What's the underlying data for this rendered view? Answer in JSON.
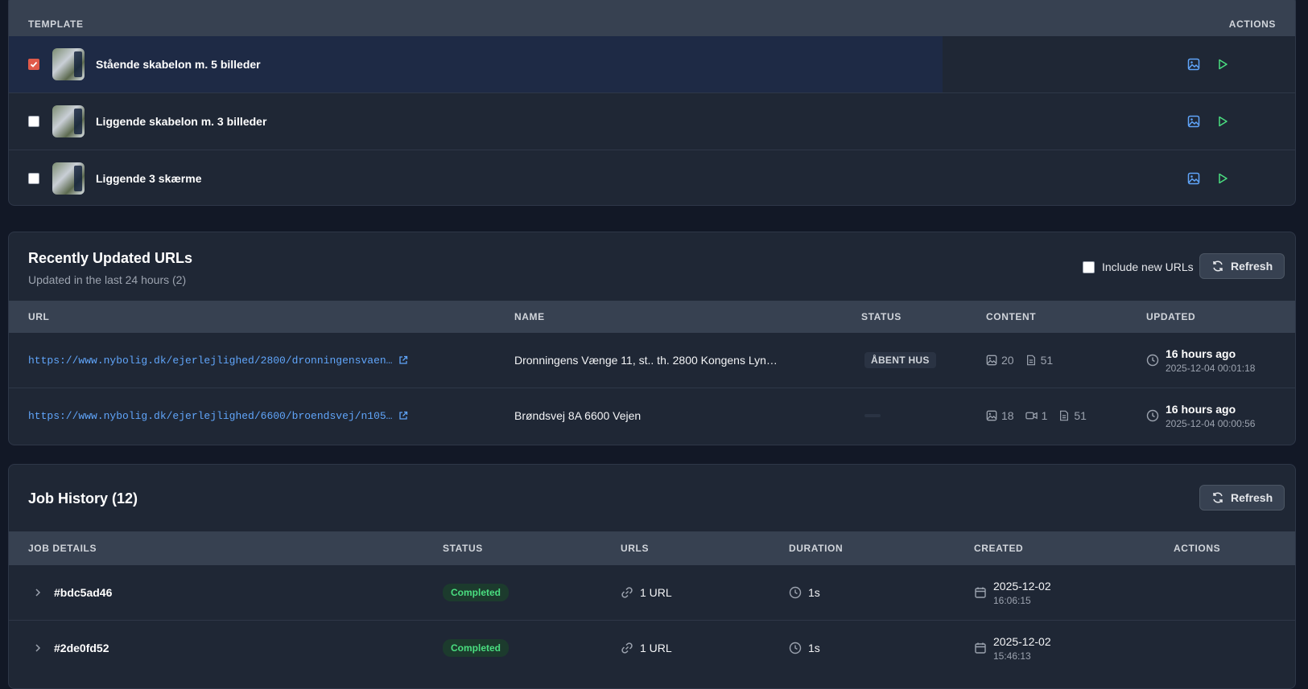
{
  "templates": {
    "header": {
      "template": "TEMPLATE",
      "actions": "ACTIONS"
    },
    "rows": [
      {
        "name": "Stående skabelon m. 5 billeder",
        "checked": true
      },
      {
        "name": "Liggende skabelon m. 3 billeder",
        "checked": false
      },
      {
        "name": "Liggende 3 skærme",
        "checked": false
      }
    ]
  },
  "recent": {
    "title": "Recently Updated URLs",
    "subtitle": "Updated in the last 24 hours (2)",
    "include_label": "Include new URLs",
    "refresh_label": "Refresh",
    "columns": {
      "url": "URL",
      "name": "NAME",
      "status": "STATUS",
      "content": "CONTENT",
      "updated": "UPDATED"
    },
    "rows": [
      {
        "url": "https://www.nybolig.dk/ejerlejlighed/2800/dronningensvaen…",
        "name": "Dronningens Vænge 11, st.. th. 2800 Kongens Lyn…",
        "status": "ÅBENT HUS",
        "images": "20",
        "docs": "51",
        "updated": "16 hours ago",
        "updated_ts": "2025-12-04 00:01:18"
      },
      {
        "url": "https://www.nybolig.dk/ejerlejlighed/6600/broendsvej/n105…",
        "name": "Brøndsvej 8A 6600 Vejen",
        "status": "",
        "images": "18",
        "videos": "1",
        "docs": "51",
        "updated": "16 hours ago",
        "updated_ts": "2025-12-04 00:00:56"
      }
    ]
  },
  "jobs": {
    "title": "Job History (12)",
    "refresh_label": "Refresh",
    "columns": {
      "details": "JOB DETAILS",
      "status": "STATUS",
      "urls": "URLS",
      "duration": "DURATION",
      "created": "CREATED",
      "actions": "ACTIONS"
    },
    "rows": [
      {
        "id": "#bdc5ad46",
        "status": "Completed",
        "urls": "1 URL",
        "duration": "1s",
        "date": "2025-12-02",
        "time": "16:06:15"
      },
      {
        "id": "#2de0fd52",
        "status": "Completed",
        "urls": "1 URL",
        "duration": "1s",
        "date": "2025-12-02",
        "time": "15:46:13"
      }
    ]
  },
  "colors": {
    "accent_blue": "#60a5fa",
    "accent_green": "#4ade80",
    "checkbox_checked": "#e05a4a"
  }
}
